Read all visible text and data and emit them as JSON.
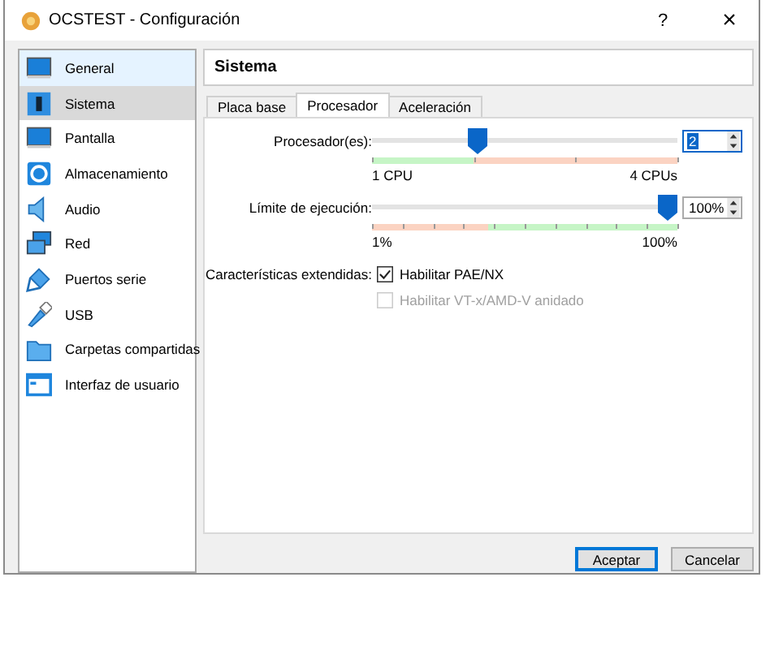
{
  "window": {
    "title": "OCSTEST - Configuración",
    "help": "?",
    "close": "×"
  },
  "sidebar": {
    "items": [
      {
        "label": "General",
        "selected": false,
        "hovered": true
      },
      {
        "label": "Sistema",
        "selected": true,
        "hovered": false
      },
      {
        "label": "Pantalla",
        "selected": false,
        "hovered": false
      },
      {
        "label": "Almacenamiento",
        "selected": false,
        "hovered": false
      },
      {
        "label": "Audio",
        "selected": false,
        "hovered": false
      },
      {
        "label": "Red",
        "selected": false,
        "hovered": false
      },
      {
        "label": "Puertos serie",
        "selected": false,
        "hovered": false
      },
      {
        "label": "USB",
        "selected": false,
        "hovered": false
      },
      {
        "label": "Carpetas compartidas",
        "selected": false,
        "hovered": false
      },
      {
        "label": "Interfaz de usuario",
        "selected": false,
        "hovered": false
      }
    ]
  },
  "section_title": "Sistema",
  "tabs": [
    {
      "label": "Placa base",
      "selected": false
    },
    {
      "label": "Procesador",
      "selected": true
    },
    {
      "label": "Aceleración",
      "selected": false
    }
  ],
  "sliders": [
    {
      "label": "Procesador(es):",
      "level": 0.333,
      "value": "2",
      "value_selected": true,
      "min_label": "1 CPU",
      "max_label": "4 CPUs"
    },
    {
      "label": "Límite de ejecución:",
      "level": 1,
      "value": "100%",
      "value_selected": false,
      "min_label": "1%",
      "max_label": "100%"
    }
  ],
  "extended": {
    "label": "Características extendidas:",
    "options": [
      {
        "label": "Habilitar PAE/NX",
        "checked": true,
        "disabled": false
      },
      {
        "label": "Habilitar VT-x/AMD-V anidado",
        "checked": false,
        "disabled": true
      }
    ]
  },
  "buttons": [
    {
      "label": "Aceptar",
      "default": true
    },
    {
      "label": "Cancelar",
      "default": false
    }
  ]
}
